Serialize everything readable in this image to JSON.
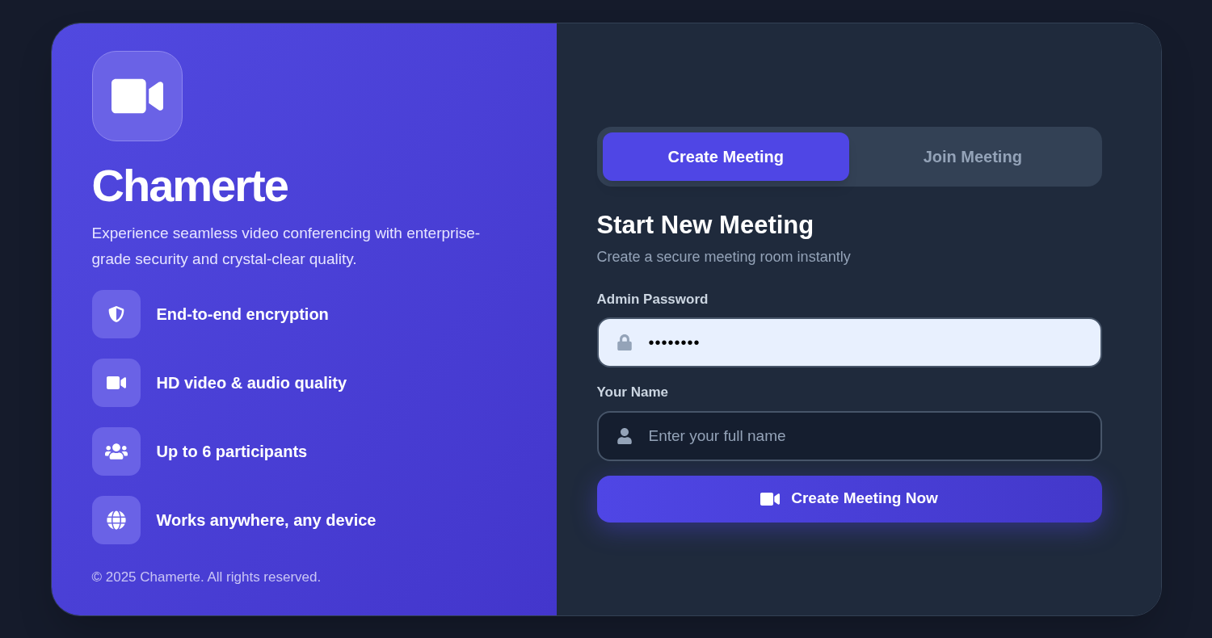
{
  "brand": {
    "name": "Chamerte",
    "tagline": "Experience seamless video conferencing with enterprise-grade security and crystal-clear quality."
  },
  "features": [
    {
      "kind": "shield",
      "label": "End-to-end encryption"
    },
    {
      "kind": "video",
      "label": "HD video & audio quality"
    },
    {
      "kind": "users",
      "label": "Up to 6 participants"
    },
    {
      "kind": "globe",
      "label": "Works anywhere, any device"
    }
  ],
  "footer": "© 2025 Chamerte. All rights reserved.",
  "tabs": [
    {
      "label": "Create Meeting",
      "selected": true
    },
    {
      "label": "Join Meeting",
      "selected": false
    }
  ],
  "form": {
    "title": "Start New Meeting",
    "subtitle": "Create a secure meeting room instantly",
    "fields": [
      {
        "kind": "password",
        "label": "Admin Password",
        "value": "••••••••"
      },
      {
        "kind": "name",
        "label": "Your Name",
        "placeholder": "Enter your full name"
      }
    ],
    "submit": "Create Meeting Now"
  }
}
